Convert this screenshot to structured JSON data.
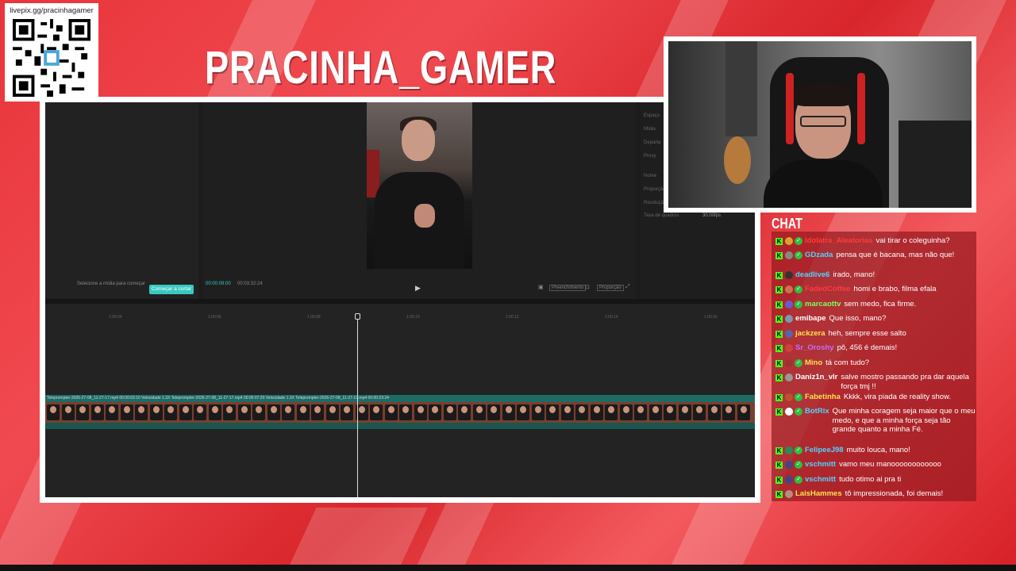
{
  "overlay": {
    "qr_url": "livepix.gg/pracinhagamer",
    "channel_title": "PRACINHA_GAMER",
    "chat_title": "CHAT"
  },
  "editor": {
    "props": [
      "Espaço",
      "Mídia",
      "Departa",
      "Proxy",
      "Nome",
      "Proporção",
      "Resolução",
      "Taxa de quadros"
    ],
    "frame_rate_value": "30.00fps",
    "select_media_hint": "Selecione a mídia para começar",
    "start_cut_button": "Começar a cortar",
    "time_current": "00:00:09:00",
    "time_total": "00:03:32:24",
    "fill_label": "Preenchimento",
    "ratio_label": "Proporção",
    "ruler_ticks": [
      "1:00:04",
      "1:00:06",
      "1:00:08",
      "1:00:10",
      "1:00:12",
      "1:00:14",
      "1:00:16"
    ],
    "track_label": "Teleprompter-2026-27-08_11-27-17.mp4  00:00:03:10   Velocidade 1.3X  Teleprompter-2026-27-08_11-27-17.mp4  00:00:07:20   Velocidade 1.3X  Teleprompter-2026-27-08_11-27-17.mp4  00:00:23:24"
  },
  "chat": {
    "messages": [
      {
        "user": "Idolatra_Aleatorias",
        "color": "#ff3c3c",
        "verified": true,
        "badge": "#e0a030",
        "text": "vai tirar o coleguinha?"
      },
      {
        "user": "GDzada",
        "color": "#4fd4ff",
        "verified": true,
        "badge": "#888888",
        "text": "pensa que é bacana, mas não que!"
      },
      {
        "user": "deadlive6",
        "color": "#4fd4ff",
        "verified": false,
        "badge": "#333333",
        "text": "irado, mano!"
      },
      {
        "user": "FadedCoffee",
        "color": "#ff3c3c",
        "verified": true,
        "badge": "#d07050",
        "text": "homi e brabo, filma efala"
      },
      {
        "user": "marcaottv",
        "color": "#7dff5a",
        "verified": true,
        "badge": "#6a5acd",
        "text": "sem medo, fica firme."
      },
      {
        "user": "emibape",
        "color": "#ffffff",
        "verified": false,
        "badge": "#7a9ab0",
        "text": "Que isso, mano?"
      },
      {
        "user": "jackzera",
        "color": "#ffe14d",
        "verified": false,
        "badge": "#5566aa",
        "text": "heh, sempre esse salto"
      },
      {
        "user": "Sr_Oroshy",
        "color": "#c86bff",
        "verified": false,
        "badge": "#d04040",
        "text": "pô, 456 é demais!"
      },
      {
        "user": "Mino",
        "color": "#ffe14d",
        "verified": true,
        "badge": "#a03030",
        "text": "tá com tudo?"
      },
      {
        "user": "Daniz1n_vlr",
        "color": "#ffffff",
        "verified": false,
        "badge": "#999999",
        "text": "salve mostro passando pra dar aquela força tmj !!"
      },
      {
        "user": "Fabetinha",
        "color": "#ffe14d",
        "verified": true,
        "badge": "#c05030",
        "text": "Kkkk, vira piada de reality show."
      },
      {
        "user": "BotRix",
        "color": "#4fd4ff",
        "verified": true,
        "badge": "#ffffff",
        "text": "Que minha coragem seja maior que o meu medo, e que a minha força seja tão grande quanto a minha Fé."
      },
      {
        "user": "FelipeeJ98",
        "color": "#4fd4ff",
        "verified": true,
        "badge": "#2a8a5a",
        "text": "muito louca, mano!"
      },
      {
        "user": "vschmitt",
        "color": "#4fd4ff",
        "verified": true,
        "badge": "#444488",
        "text": "vamo meu manoooooooooooo"
      },
      {
        "user": "vschmitt",
        "color": "#4fd4ff",
        "verified": true,
        "badge": "#444488",
        "text": "tudo otimo ai pra ti"
      },
      {
        "user": "LaisHammes",
        "color": "#ffe14d",
        "verified": false,
        "badge": "#b09080",
        "text": "tô impressionada, foi demais!"
      }
    ]
  }
}
